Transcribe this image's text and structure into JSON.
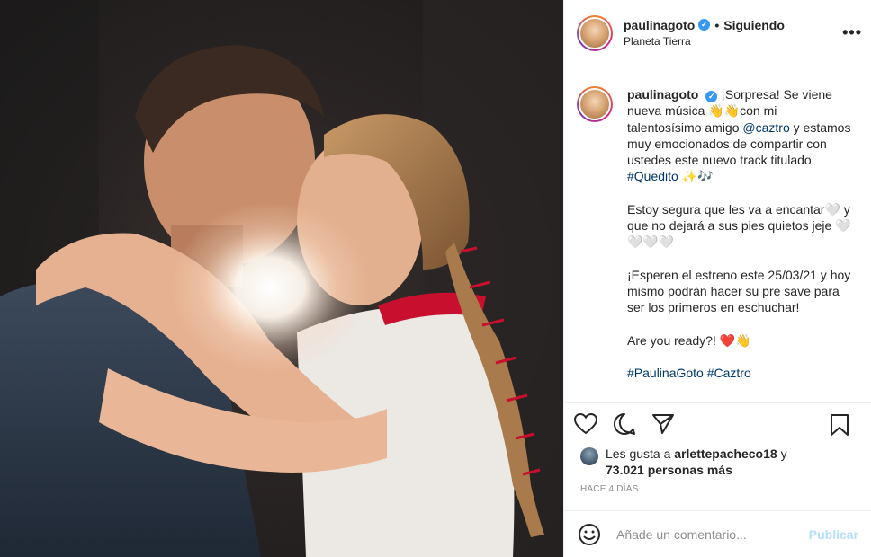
{
  "post": {
    "author": {
      "username": "paulinagoto",
      "verified_icon": "verified-badge-icon",
      "follow_status": "Siguiendo",
      "location": "Planeta Tierra"
    },
    "caption": {
      "username": "paulinagoto",
      "paragraph1_a": "¡Sorpresa! Se viene nueva música 👋👋con mi talentosísimo amigo ",
      "mention": "@caztro",
      "paragraph1_b": " y estamos muy emocionados de compartir con ustedes este nuevo track titulado ",
      "hashtag_quedito": "#Quedito",
      "paragraph1_c": " ✨🎶",
      "paragraph2": "Estoy segura que les va a encantar🤍 y que no dejará a sus pies quietos jeje 🤍🤍🤍🤍",
      "paragraph3": "¡Esperen el estreno este 25/03/21 y hoy mismo podrán hacer su pre save para ser los primeros en eschuchar!",
      "paragraph4": "Are you ready?! ❤️👋",
      "hashtag_paulina": "#PaulinaGoto",
      "hashtag_caztro": "#Caztro"
    },
    "likes": {
      "prefix": "Les gusta a ",
      "user": "arlettepacheco18",
      "middle": " y ",
      "count": "73.021 personas más"
    },
    "time": "HACE 4 DÍAS",
    "comment": {
      "placeholder": "Añade un comentario...",
      "publish_label": "Publicar"
    },
    "icons": {
      "more": "more-options-icon",
      "like": "heart-icon",
      "comment": "comment-icon",
      "share": "share-icon",
      "save": "bookmark-icon",
      "emoji": "emoji-icon"
    },
    "colors": {
      "link": "#00376b",
      "publish": "#b2dffc",
      "muted": "#8e8e8e",
      "verified": "#3897f0"
    }
  }
}
